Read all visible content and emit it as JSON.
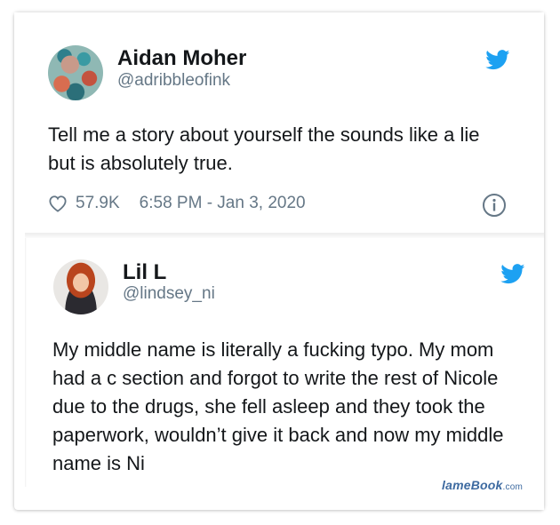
{
  "colors": {
    "twitter_blue": "#1da1f2",
    "text": "#14171a",
    "secondary_text": "#657786",
    "watermark": "#3d6aa0"
  },
  "tweet": {
    "author_name": "Aidan Moher",
    "handle": "@adribbleofink",
    "text": "Tell me a story about yourself the sounds like a lie but is absolutely true.",
    "likes": "57.9K",
    "timestamp": "6:58 PM - Jan 3, 2020",
    "icons": [
      "twitter-bird-icon",
      "heart-icon",
      "info-icon"
    ]
  },
  "reply": {
    "author_name": "Lil L",
    "handle": "@lindsey_ni",
    "text": "My middle name is literally a fucking typo. My mom had a c section and forgot to write the rest of Nicole due to the drugs, she fell asleep and they took the paperwork, wouldn’t give it back and now my middle name is Ni",
    "icons": [
      "twitter-bird-icon"
    ]
  },
  "watermark": {
    "brand": "lameBook",
    "tld": ".com"
  }
}
